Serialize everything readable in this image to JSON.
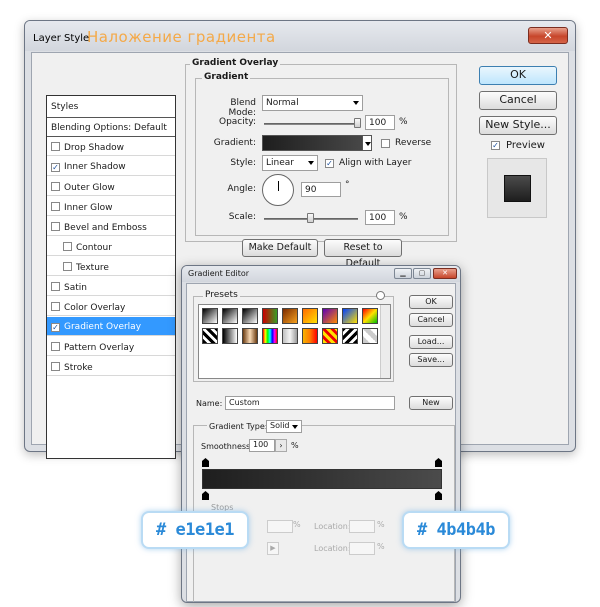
{
  "layer_style": {
    "title": "Layer Style",
    "subtitle": "Наложение градиента",
    "close_glyph": "✕",
    "styles_list": {
      "header": "Styles",
      "blending": "Blending Options: Default",
      "items": [
        {
          "label": "Drop Shadow",
          "checked": false,
          "selected": false,
          "indent": false
        },
        {
          "label": "Inner Shadow",
          "checked": true,
          "selected": false,
          "indent": false
        },
        {
          "label": "Outer Glow",
          "checked": false,
          "selected": false,
          "indent": false
        },
        {
          "label": "Inner Glow",
          "checked": false,
          "selected": false,
          "indent": false
        },
        {
          "label": "Bevel and Emboss",
          "checked": false,
          "selected": false,
          "indent": false
        },
        {
          "label": "Contour",
          "checked": false,
          "selected": false,
          "indent": true
        },
        {
          "label": "Texture",
          "checked": false,
          "selected": false,
          "indent": true
        },
        {
          "label": "Satin",
          "checked": false,
          "selected": false,
          "indent": false
        },
        {
          "label": "Color Overlay",
          "checked": false,
          "selected": false,
          "indent": false
        },
        {
          "label": "Gradient Overlay",
          "checked": true,
          "selected": true,
          "indent": false
        },
        {
          "label": "Pattern Overlay",
          "checked": false,
          "selected": false,
          "indent": false
        },
        {
          "label": "Stroke",
          "checked": false,
          "selected": false,
          "indent": false
        }
      ]
    },
    "panel": {
      "group_title": "Gradient Overlay",
      "subgroup_title": "Gradient",
      "blend_mode_label": "Blend Mode:",
      "blend_mode_value": "Normal",
      "opacity_label": "Opacity:",
      "opacity_value": "100",
      "opacity_level": 1.0,
      "percent": "%",
      "gradient_label": "Gradient:",
      "reverse_label": "Reverse",
      "style_label": "Style:",
      "style_value": "Linear",
      "align_label": "Align with Layer",
      "angle_label": "Angle:",
      "angle_value": "90",
      "degree": "°",
      "scale_label": "Scale:",
      "scale_value": "100",
      "scale_level": 0.5,
      "make_default": "Make Default",
      "reset_default": "Reset to Default"
    },
    "buttons": {
      "ok": "OK",
      "cancel": "Cancel",
      "new_style": "New Style...",
      "preview_label": "Preview"
    }
  },
  "gradient_editor": {
    "title": "Gradient Editor",
    "presets_label": "Presets",
    "ok": "OK",
    "cancel": "Cancel",
    "load": "Load...",
    "save": "Save...",
    "name_label": "Name:",
    "name_value": "Custom",
    "new_button": "New",
    "gradient_type_label": "Gradient Type:",
    "gradient_type_value": "Solid",
    "smoothness_label": "Smoothness:",
    "smoothness_value": "100",
    "percent": "%",
    "stops_label": "Stops",
    "location_label": "Location:",
    "preset_swatches": [
      "linear-gradient(135deg,#000,#fff)",
      "linear-gradient(135deg,#000,#fff)",
      "linear-gradient(135deg,#000,#fff)",
      "linear-gradient(90deg,#c00,#3a9d23)",
      "linear-gradient(135deg,#7b2a00,#f6a11d)",
      "linear-gradient(135deg,#ff6a00,#ffe100)",
      "linear-gradient(135deg,#5e00b4,#ff8a00)",
      "linear-gradient(135deg,#0040ff,#ffe100)",
      "linear-gradient(135deg,#ff0000,#ffe100,#00c000)",
      "repeating-linear-gradient(45deg,#000 0 3px,#fff 3px 6px)",
      "linear-gradient(90deg,#000,#fff)",
      "linear-gradient(90deg,#6b3c12,#f8d9b5,#6b3c12)",
      "linear-gradient(90deg,#ff0000,#ffff00,#00ff00,#00ffff,#0000ff,#ff00ff,#ff0000)",
      "linear-gradient(90deg,#c0c0c0,#f4f4f4,#9a9a9a)",
      "linear-gradient(90deg,#f7b300,#ff7a00,#ff0000)",
      "repeating-linear-gradient(45deg,#ffe000 0 3px,#e00 3px 6px)",
      "repeating-linear-gradient(-45deg,#000 0 3px,#fff 3px 6px)",
      "linear-gradient(45deg,#ccc 25%,#fff 25%,#fff 50%,#ccc 50%,#ccc 75%,#fff 75%)"
    ],
    "gradient_colors": [
      "#1e1e1e",
      "#4b4b4b"
    ]
  },
  "hex_labels": {
    "left": "# e1e1e1",
    "right": "# 4b4b4b"
  }
}
